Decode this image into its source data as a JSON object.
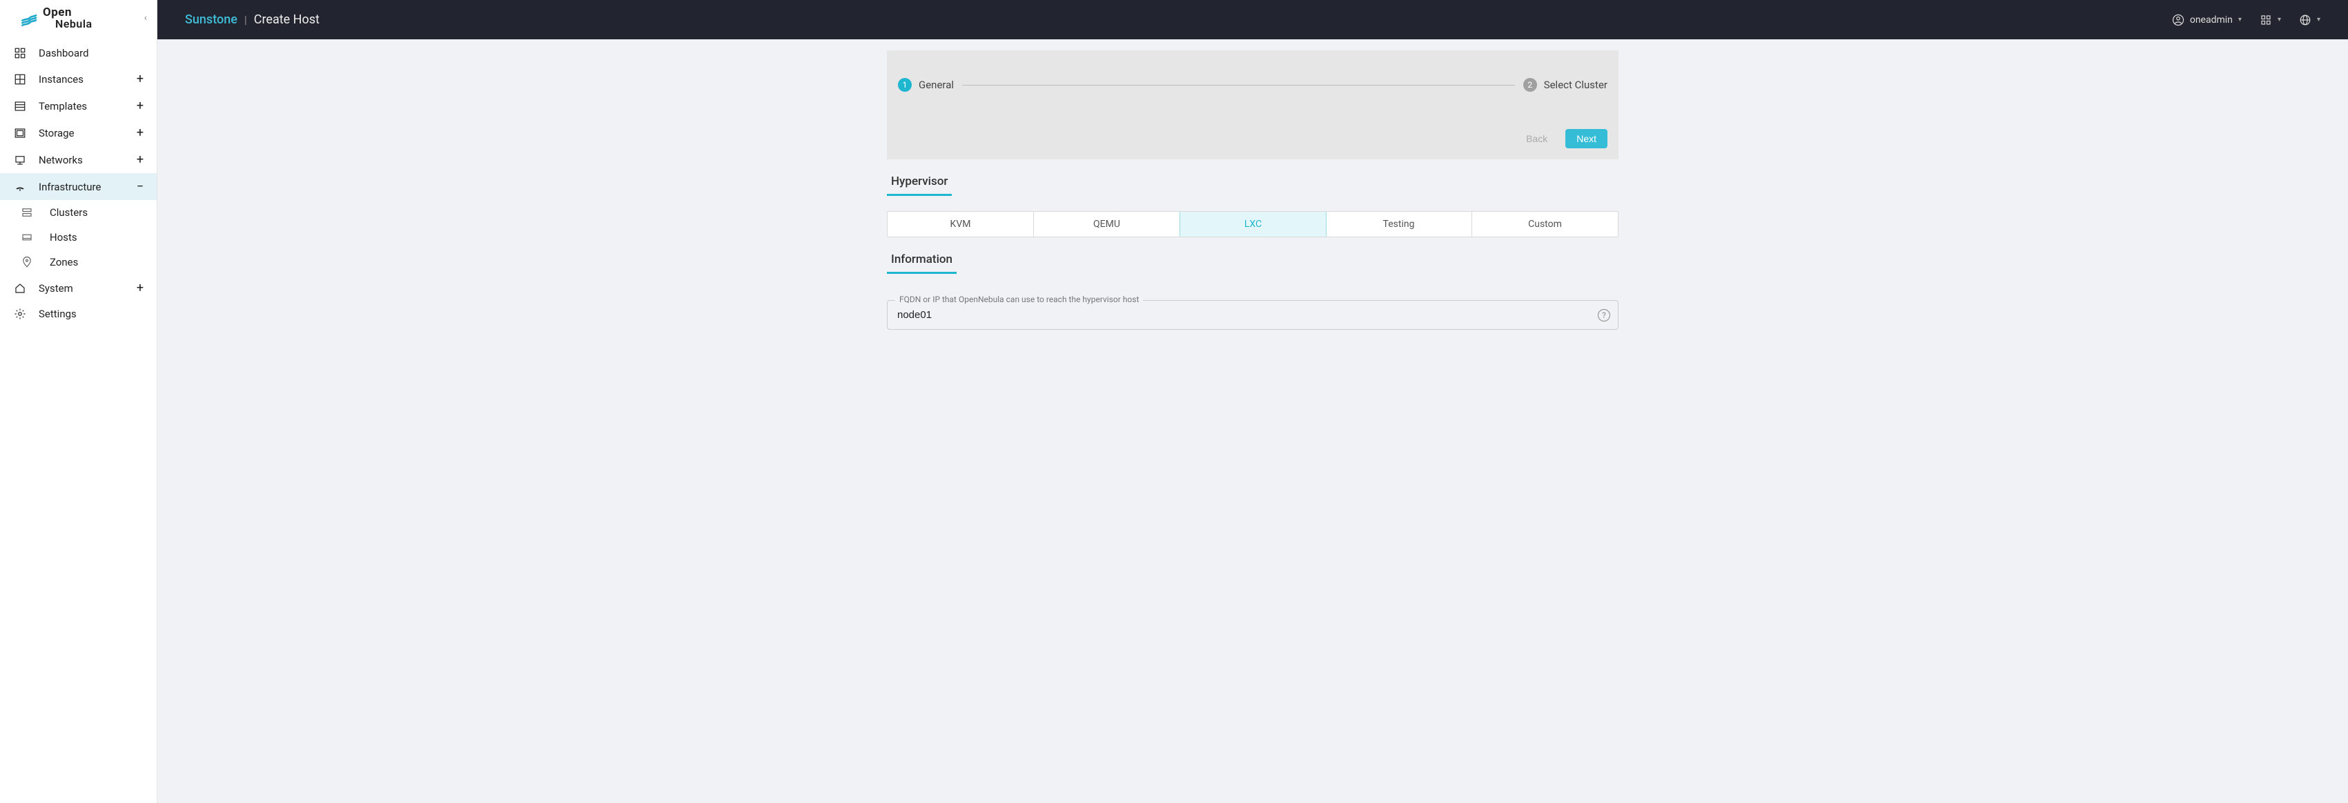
{
  "logo": {
    "line1": "Open",
    "line2": "Nebula"
  },
  "sidebar": {
    "items": [
      {
        "label": "Dashboard",
        "expandable": false
      },
      {
        "label": "Instances",
        "expandable": true
      },
      {
        "label": "Templates",
        "expandable": true
      },
      {
        "label": "Storage",
        "expandable": true
      },
      {
        "label": "Networks",
        "expandable": true
      },
      {
        "label": "Infrastructure",
        "expandable": true,
        "active": true,
        "expanded": true
      },
      {
        "label": "System",
        "expandable": true
      },
      {
        "label": "Settings",
        "expandable": false
      }
    ],
    "infra_children": [
      {
        "label": "Clusters"
      },
      {
        "label": "Hosts"
      },
      {
        "label": "Zones"
      }
    ]
  },
  "topbar": {
    "brand": "Sunstone",
    "page": "Create Host",
    "user": "oneadmin"
  },
  "wizard": {
    "step1": {
      "num": "1",
      "label": "General"
    },
    "step2": {
      "num": "2",
      "label": "Select Cluster"
    },
    "back": "Back",
    "next": "Next"
  },
  "sections": {
    "hypervisor_title": "Hypervisor",
    "information_title": "Information"
  },
  "hypervisors": [
    "KVM",
    "QEMU",
    "LXC",
    "Testing",
    "Custom"
  ],
  "hypervisor_selected": "LXC",
  "host_field": {
    "label": "FQDN or IP that OpenNebula can use to reach the hypervisor host",
    "value": "node01"
  }
}
